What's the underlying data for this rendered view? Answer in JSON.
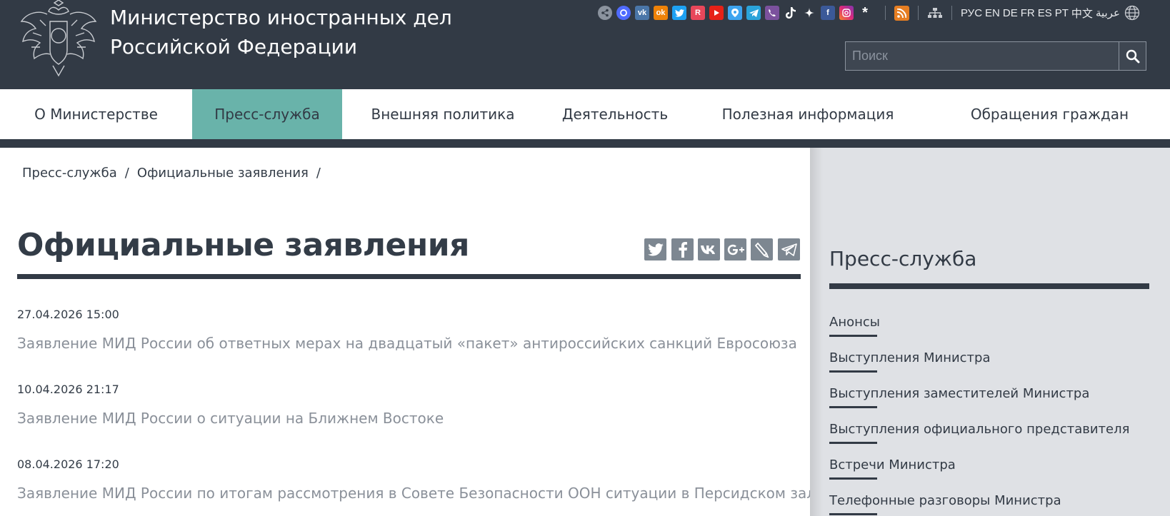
{
  "header": {
    "title_line1": "Министерство иностранных дел",
    "title_line2": "Российской Федерации",
    "social_icons": [
      "share-icon",
      "max-icon",
      "vk-icon",
      "odnoklassniki-icon",
      "twitter-icon",
      "rutube-icon",
      "youtube-icon",
      "dzen-map-icon",
      "telegram-icon",
      "viber-icon",
      "tiktok-icon",
      "star-icon",
      "facebook-icon",
      "instagram-icon",
      "asterisk-icon"
    ],
    "languages": [
      "РУС",
      "EN",
      "DE",
      "FR",
      "ES",
      "PT",
      "中文",
      "عربية"
    ],
    "search_placeholder": "Поиск"
  },
  "nav": {
    "items": [
      {
        "label": "О Министерстве",
        "active": false
      },
      {
        "label": "Пресс-служба",
        "active": true
      },
      {
        "label": "Внешняя политика",
        "active": false
      },
      {
        "label": "Деятельность",
        "active": false
      },
      {
        "label": "Полезная информация",
        "active": false
      },
      {
        "label": "Обращения граждан",
        "active": false
      }
    ]
  },
  "breadcrumb": {
    "items": [
      "Пресс-служба",
      "Официальные заявления"
    ],
    "separator": "/"
  },
  "main": {
    "title": "Официальные заявления",
    "share_icons": [
      "twitter-icon",
      "facebook-icon",
      "vk-icon",
      "google-plus-icon",
      "livejournal-icon",
      "telegram-icon"
    ],
    "news": [
      {
        "date": "27.04.2026 15:00",
        "title": "Заявление МИД России об ответных мерах на двадцатый «пакет» антироссийских санкций Евросоюза"
      },
      {
        "date": "10.04.2026 21:17",
        "title": "Заявление МИД России о ситуации на Ближнем Востоке"
      },
      {
        "date": "08.04.2026 17:20",
        "title": "Заявление МИД России по итогам рассмотрения в Совете Безопасности ООН ситуации в Персидском заливе"
      }
    ]
  },
  "sidebar": {
    "title": "Пресс-служба",
    "links": [
      "Анонсы",
      "Выступления Министра",
      "Выступления заместителей Министра",
      "Выступления официального представителя",
      "Встречи Министра",
      "Телефонные разговоры Министра"
    ]
  },
  "colors": {
    "header_bg": "#323a45",
    "active_nav": "#69b3aa",
    "sidebar_bg": "#dfe1e5",
    "link_gray": "#8a9099"
  }
}
